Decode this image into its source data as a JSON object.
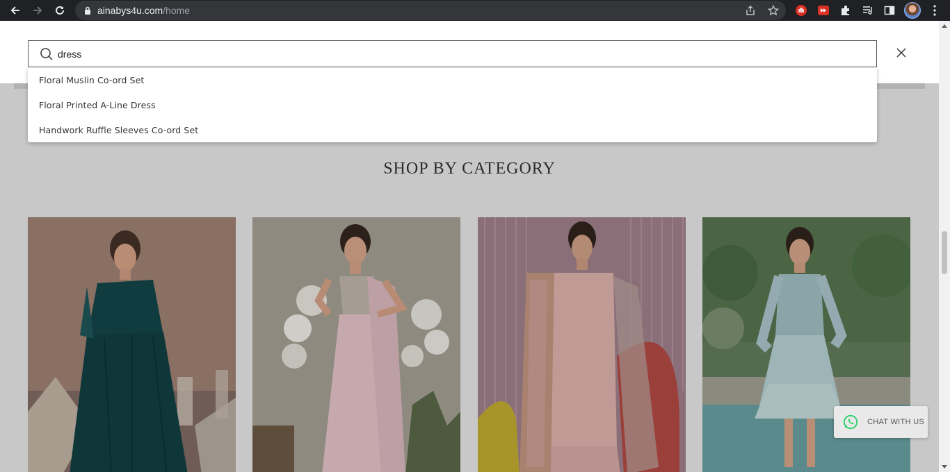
{
  "browser": {
    "url_host": "ainabys4u.com",
    "url_path": "/home"
  },
  "search": {
    "value": "dress",
    "suggestions": [
      "Floral Muslin Co-ord Set",
      "Floral Printed A-Line Dress",
      "Handwork Ruffle Sleeves Co-ord Set"
    ]
  },
  "main": {
    "section_title": "SHOP BY CATEGORY"
  },
  "chat": {
    "label": "CHAT WITH US"
  },
  "colors": {
    "chrome": "#202124",
    "overlay": "#c8c8c8",
    "whatsapp": "#25d366"
  }
}
